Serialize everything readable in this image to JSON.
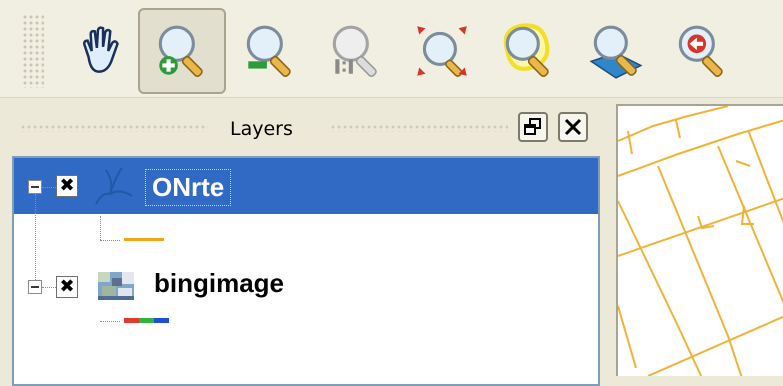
{
  "toolbar": {
    "tools": [
      {
        "name": "pan-tool",
        "icon": "hand-icon"
      },
      {
        "name": "zoom-in-tool",
        "icon": "zoom-in-icon",
        "active": true
      },
      {
        "name": "zoom-out-tool",
        "icon": "zoom-out-icon"
      },
      {
        "name": "zoom-actual-tool",
        "icon": "zoom-actual-size-icon"
      },
      {
        "name": "zoom-full-tool",
        "icon": "zoom-full-extent-icon"
      },
      {
        "name": "zoom-selection-tool",
        "icon": "zoom-to-selection-icon"
      },
      {
        "name": "zoom-layer-tool",
        "icon": "zoom-to-layer-icon"
      },
      {
        "name": "zoom-last-tool",
        "icon": "zoom-last-icon"
      }
    ]
  },
  "layers_panel": {
    "title": "Layers",
    "layers": [
      {
        "name": "ONrte",
        "visible": true,
        "selected": true,
        "symbol_color": "#f0a51a"
      },
      {
        "name": "bingimage",
        "visible": true,
        "selected": false,
        "symbol_colors": [
          "#e23b2e",
          "#34b240",
          "#1f4fd8"
        ]
      }
    ]
  },
  "colors": {
    "selection": "#316ac5",
    "road": "#f0b33a"
  }
}
